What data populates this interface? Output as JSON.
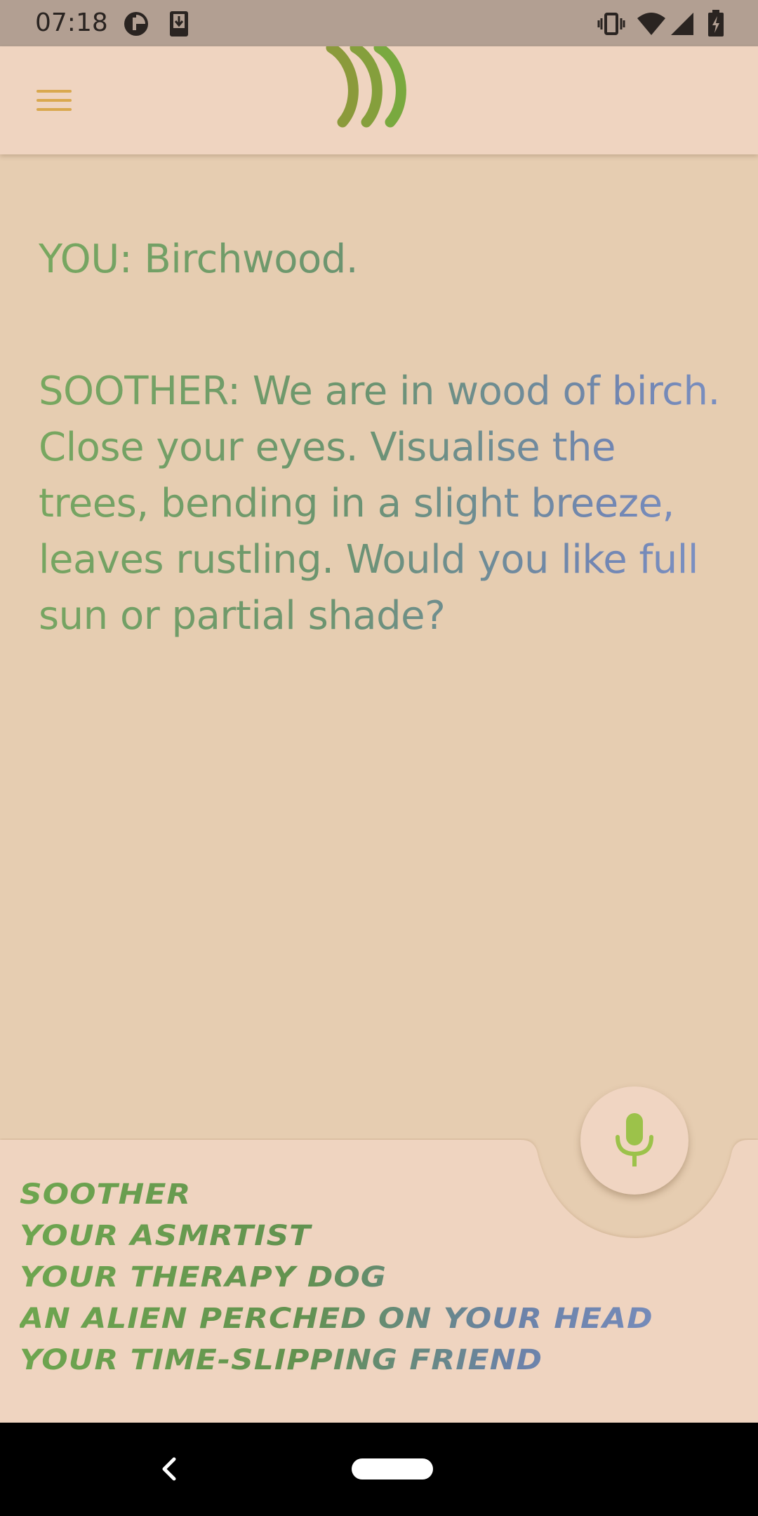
{
  "status_bar": {
    "time": "07:18",
    "left_icons": [
      "data-saver-icon",
      "download-icon"
    ],
    "right_icons": [
      "vibrate-icon",
      "wifi-icon",
      "signal-icon",
      "battery-charging-icon"
    ]
  },
  "app_bar": {
    "menu_icon": "hamburger-menu-icon",
    "logo_icon": "soother-waves-logo"
  },
  "transcript": {
    "user_message": "YOU: Birchwood.",
    "assistant_message": "SOOTHER: We are in wood of birch. Close your eyes. Visualise the trees, bending in a slight breeze, leaves rustling. Would you like full sun or partial shade?"
  },
  "personas": [
    "Soother",
    "Your ASMRtist",
    "Your therapy dog",
    "An alien perched on your head",
    "Your time-slipping friend"
  ],
  "mic": {
    "icon": "microphone-icon"
  },
  "nav_bar": {
    "back_icon": "back-chevron-icon",
    "home_icon": "home-pill-icon"
  },
  "colors": {
    "status_bar": "#b29f92",
    "app_bar": "#efd4c0",
    "background": "#e6cdb1",
    "panel": "#efd4c0",
    "text_green": "#6ea64f",
    "text_blue": "#7a8fc2",
    "menu_icon": "#d9a84e",
    "mic_icon": "#9cc24a",
    "logo_olive": "#8a9a3a",
    "logo_green": "#7aa83e"
  }
}
